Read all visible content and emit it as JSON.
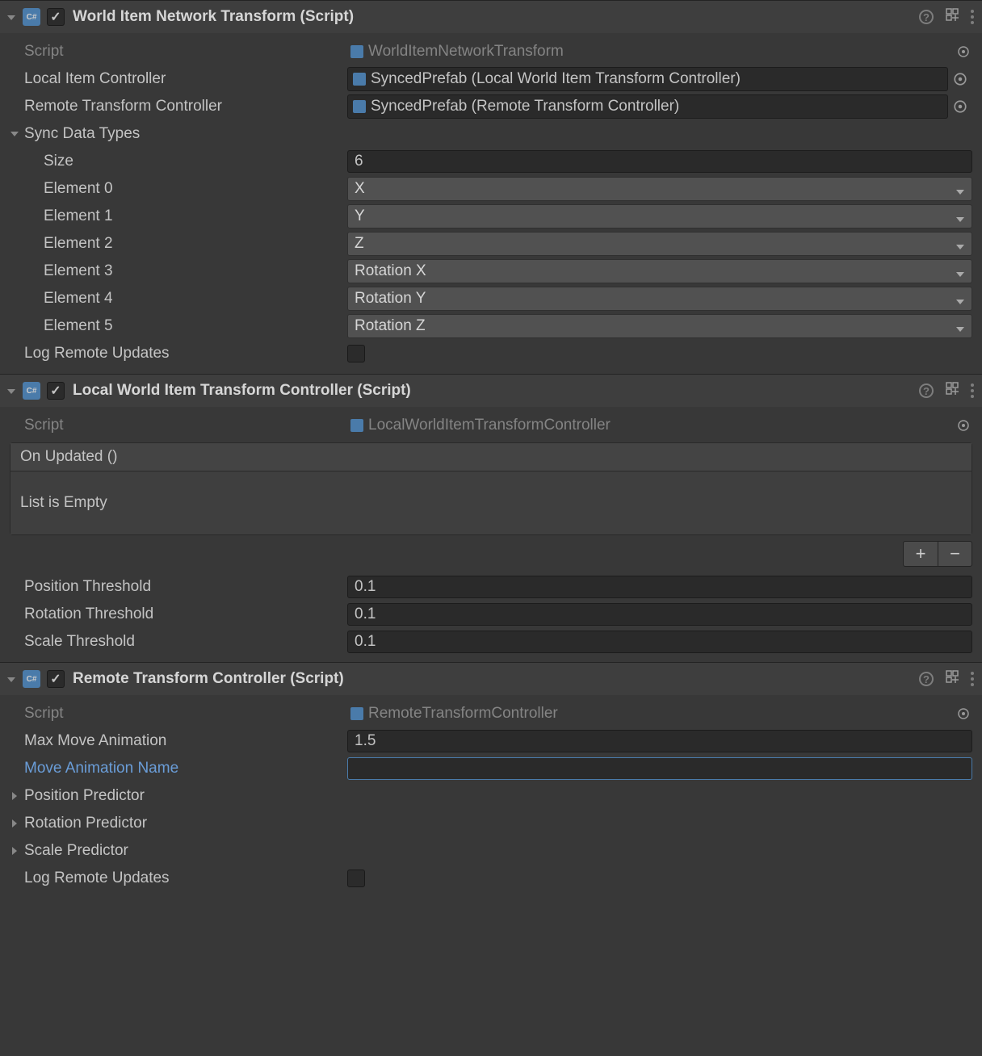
{
  "components": [
    {
      "title": "World Item Network Transform (Script)",
      "script": {
        "label": "Script",
        "value": "WorldItemNetworkTransform"
      },
      "fields": {
        "localItemController": {
          "label": "Local Item Controller",
          "value": "SyncedPrefab (Local World Item Transform Controller)"
        },
        "remoteTransformController": {
          "label": "Remote Transform Controller",
          "value": "SyncedPrefab (Remote Transform Controller)"
        }
      },
      "syncData": {
        "label": "Sync Data Types",
        "sizeLabel": "Size",
        "sizeValue": "6",
        "elements": [
          {
            "label": "Element 0",
            "value": "X"
          },
          {
            "label": "Element 1",
            "value": "Y"
          },
          {
            "label": "Element 2",
            "value": "Z"
          },
          {
            "label": "Element 3",
            "value": "Rotation X"
          },
          {
            "label": "Element 4",
            "value": "Rotation Y"
          },
          {
            "label": "Element 5",
            "value": "Rotation Z"
          }
        ]
      },
      "logRemote": {
        "label": "Log Remote Updates"
      }
    },
    {
      "title": "Local World Item Transform Controller (Script)",
      "script": {
        "label": "Script",
        "value": "LocalWorldItemTransformController"
      },
      "event": {
        "header": "On Updated ()",
        "empty": "List is Empty"
      },
      "thresholds": {
        "position": {
          "label": "Position Threshold",
          "value": "0.1"
        },
        "rotation": {
          "label": "Rotation Threshold",
          "value": "0.1"
        },
        "scale": {
          "label": "Scale Threshold",
          "value": "0.1"
        }
      }
    },
    {
      "title": "Remote Transform Controller (Script)",
      "script": {
        "label": "Script",
        "value": "RemoteTransformController"
      },
      "maxMove": {
        "label": "Max Move Animation",
        "value": "1.5"
      },
      "moveAnim": {
        "label": "Move Animation Name",
        "value": ""
      },
      "predictors": {
        "position": "Position Predictor",
        "rotation": "Rotation Predictor",
        "scale": "Scale Predictor"
      },
      "logRemote": {
        "label": "Log Remote Updates"
      }
    }
  ]
}
